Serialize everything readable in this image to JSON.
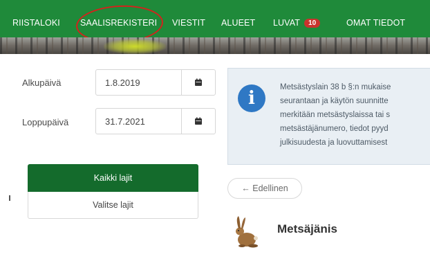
{
  "nav": {
    "items": [
      {
        "label": "RIISTALOKI"
      },
      {
        "label": "SAALISREKISTERI"
      },
      {
        "label": "VIESTIT"
      },
      {
        "label": "ALUEET"
      },
      {
        "label": "LUVAT",
        "badge": "10"
      },
      {
        "label": "OMAT TIEDOT"
      }
    ],
    "active_color": "#1f8a3a",
    "badge_color": "#c9332d"
  },
  "form": {
    "start_label": "Alkupäivä",
    "start_value": "1.8.2019",
    "end_label": "Loppupäivä",
    "end_value": "31.7.2021"
  },
  "species_buttons": {
    "all_label": "Kaikki lajit",
    "pick_label": "Valitse lajit"
  },
  "info": {
    "icon": "info-icon",
    "lines": [
      "Metsästyslain 38 b §:n mukaise",
      "seurantaan ja käytön suunnitte",
      "merkitään metsästyslaissa tai s",
      "metsästäjänumero, tiedot pyyd",
      "julkisuudesta ja luovuttamisest"
    ]
  },
  "pager": {
    "prev_label": "← Edellinen"
  },
  "species": {
    "title": "Metsäjänis",
    "icon": "hare-icon"
  }
}
